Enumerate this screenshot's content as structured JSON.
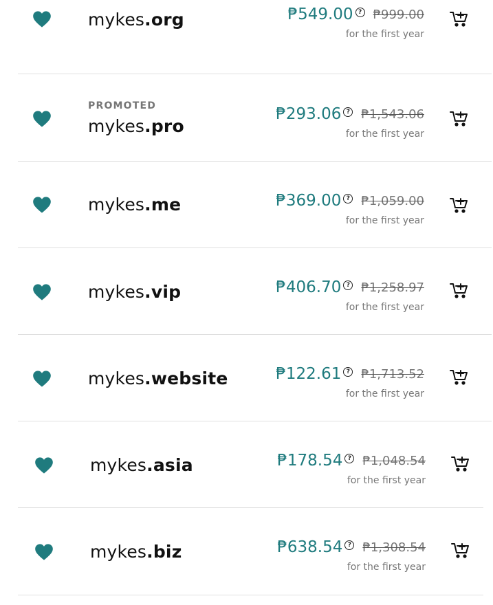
{
  "subtitle": "for the first year",
  "promoted_label": "PROMOTED",
  "accent_color": "#1f7b7e",
  "icons": {
    "favorite": "heart-icon",
    "cart": "add-to-cart-icon",
    "info": "info-icon"
  },
  "info_glyph": "?",
  "rows": [
    {
      "name": "mykes",
      "tld": ".org",
      "price": "₱549.00",
      "original": "₱999.00",
      "promoted": false
    },
    {
      "name": "mykes",
      "tld": ".pro",
      "price": "₱293.06",
      "original": "₱1,543.06",
      "promoted": true
    },
    {
      "name": "mykes",
      "tld": ".me",
      "price": "₱369.00",
      "original": "₱1,059.00",
      "promoted": false
    },
    {
      "name": "mykes",
      "tld": ".vip",
      "price": "₱406.70",
      "original": "₱1,258.97",
      "promoted": false
    },
    {
      "name": "mykes",
      "tld": ".website",
      "price": "₱122.61",
      "original": "₱1,713.52",
      "promoted": false
    },
    {
      "name": "mykes",
      "tld": ".asia",
      "price": "₱178.54",
      "original": "₱1,048.54",
      "promoted": false
    },
    {
      "name": "mykes",
      "tld": ".biz",
      "price": "₱638.54",
      "original": "₱1,308.54",
      "promoted": false
    }
  ]
}
